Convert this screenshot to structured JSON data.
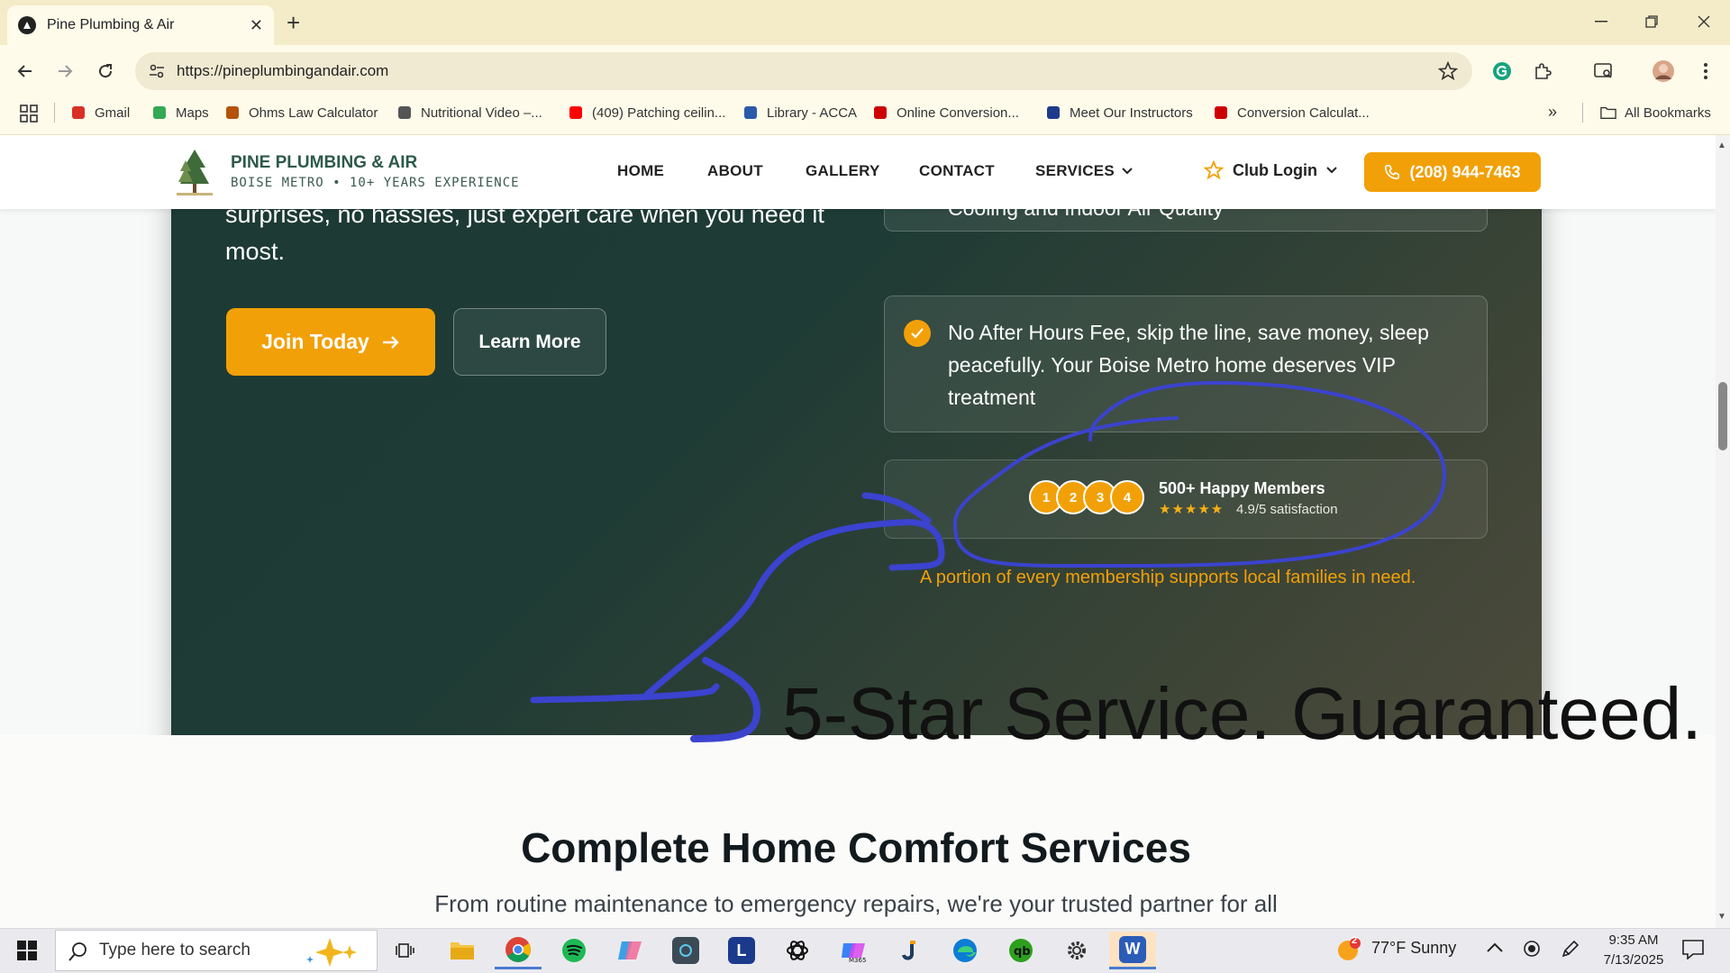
{
  "browser": {
    "tab_title": "Pine Plumbing & Air",
    "url": "https://pineplumbingandair.com",
    "bookmarks": [
      {
        "label": "Gmail",
        "icon": "gmail-icon",
        "color": "#d93025"
      },
      {
        "label": "Maps",
        "icon": "maps-icon",
        "color": "#34a853"
      },
      {
        "label": "Ohms Law Calculator",
        "icon": "ohms-icon",
        "color": "#b45309"
      },
      {
        "label": "Nutritional Video –...",
        "icon": "nutrition-icon",
        "color": "#555555"
      },
      {
        "label": "(409) Patching ceilin...",
        "icon": "youtube-icon",
        "color": "#ff0000"
      },
      {
        "label": "Library - ACCA",
        "icon": "acca-icon",
        "color": "#2b5aa8"
      },
      {
        "label": "Online Conversion...",
        "icon": "conversion-icon",
        "color": "#cc0000"
      },
      {
        "label": "Meet Our Instructors",
        "icon": "instructors-icon",
        "color": "#1e3a8a"
      },
      {
        "label": "Conversion Calculat...",
        "icon": "conversion-calc-icon",
        "color": "#cc0000"
      }
    ],
    "all_bookmarks": "All Bookmarks"
  },
  "site": {
    "brand_name": "PINE PLUMBING & AIR",
    "brand_tagline": "BOISE METRO • 10+ YEARS EXPERIENCE",
    "nav": [
      "HOME",
      "ABOUT",
      "GALLERY",
      "CONTACT",
      "SERVICES"
    ],
    "club_login": "Club Login",
    "phone": "(208) 944-7463",
    "accent": "#f2a007"
  },
  "hero": {
    "text": "surprises, no hassles, just expert care when you need it most.",
    "join_button": "Join Today",
    "learn_button": "Learn More",
    "feature_1": "regular maintenance needs for Plumbing, Heating, Cooling and Indoor Air Quality",
    "feature_2": "No After Hours Fee, skip the line, save money, sleep peacefully. Your Boise Metro home deserves VIP treatment",
    "avatars": [
      "1",
      "2",
      "3",
      "4"
    ],
    "members_title": "500+ Happy Members",
    "stars": "★★★★★",
    "satisfaction": "4.9/5 satisfaction",
    "support_note": "A portion of every membership supports local families in need."
  },
  "annotation": {
    "text": "5-Star Service. Guaranteed.",
    "ink_color": "#3b43cf"
  },
  "services": {
    "title": "Complete Home Comfort Services",
    "subtitle": "From routine maintenance to emergency repairs, we're your trusted partner for all"
  },
  "taskbar": {
    "search_placeholder": "Type here to search",
    "weather_badge": "2",
    "weather": "77°F  Sunny",
    "time": "9:35 AM",
    "date": "7/13/2025"
  }
}
